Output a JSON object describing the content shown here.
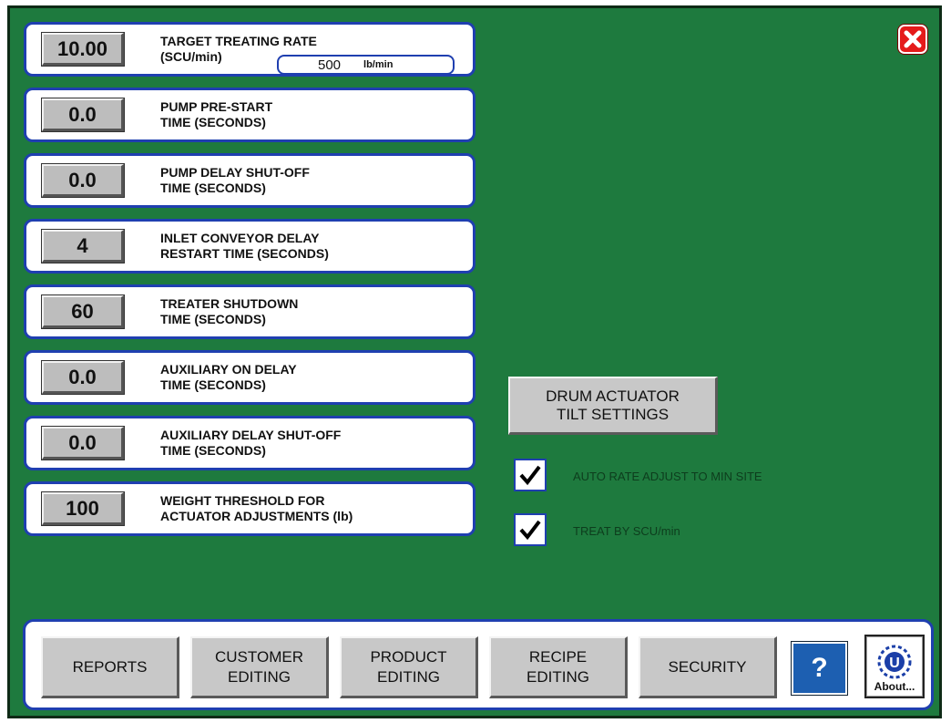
{
  "settings": [
    {
      "value": "10.00",
      "label_lines": [
        "TARGET TREATING RATE",
        "(SCU/min)"
      ]
    },
    {
      "value": "0.0",
      "label_lines": [
        "PUMP PRE-START",
        "TIME (SECONDS)"
      ]
    },
    {
      "value": "0.0",
      "label_lines": [
        "PUMP DELAY SHUT-OFF",
        "TIME (SECONDS)"
      ]
    },
    {
      "value": "4",
      "label_lines": [
        "INLET CONVEYOR DELAY",
        "RESTART TIME (SECONDS)"
      ]
    },
    {
      "value": "60",
      "label_lines": [
        "TREATER SHUTDOWN",
        "TIME (SECONDS)"
      ]
    },
    {
      "value": "0.0",
      "label_lines": [
        "AUXILIARY ON DELAY",
        "TIME (SECONDS)"
      ]
    },
    {
      "value": "0.0",
      "label_lines": [
        "AUXILIARY DELAY SHUT-OFF",
        "TIME (SECONDS)"
      ]
    },
    {
      "value": "100",
      "label_lines": [
        "WEIGHT THRESHOLD FOR",
        "ACTUATOR ADJUSTMENTS (lb)"
      ]
    }
  ],
  "rate_lbmin": {
    "value": "500",
    "unit": "lb/min"
  },
  "drum_button": {
    "lines": [
      "DRUM ACTUATOR",
      "TILT SETTINGS"
    ]
  },
  "checkboxes": [
    {
      "label": "AUTO RATE ADJUST TO MIN SITE",
      "checked": true
    },
    {
      "label": "TREAT BY SCU/min",
      "checked": true
    }
  ],
  "nav": [
    {
      "lines": [
        "REPORTS"
      ]
    },
    {
      "lines": [
        "CUSTOMER",
        "EDITING"
      ]
    },
    {
      "lines": [
        "PRODUCT",
        "EDITING"
      ]
    },
    {
      "lines": [
        "RECIPE",
        "EDITING"
      ]
    },
    {
      "lines": [
        "SECURITY"
      ]
    }
  ],
  "help_button": {
    "label": "?"
  },
  "about_button": {
    "logo_letter": "U",
    "label": "About..."
  },
  "colors": {
    "background": "#1e7a3e",
    "panel_border": "#1f3fb0",
    "button_gray": "#c8c8c8",
    "close_red": "#e51b1b",
    "help_blue": "#1d5fb1"
  },
  "icons": {
    "close": "close-x-icon",
    "checkbox": "checkmark-icon",
    "about": "logo-u-icon"
  }
}
